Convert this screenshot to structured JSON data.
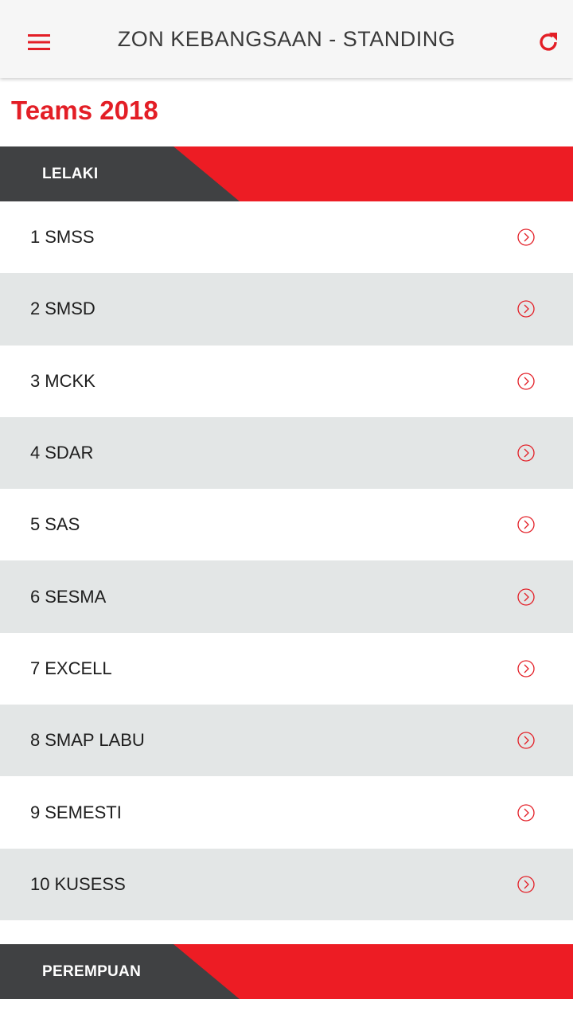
{
  "header": {
    "title": "ZON KEBANGSAAN - STANDING",
    "menu_icon": "hamburger-menu-icon",
    "refresh_icon": "refresh-icon"
  },
  "heading": "Teams 2018",
  "sections": [
    {
      "label": "LELAKI",
      "teams": [
        {
          "rank": "1",
          "name": "SMSS"
        },
        {
          "rank": "2",
          "name": "SMSD"
        },
        {
          "rank": "3",
          "name": "MCKK"
        },
        {
          "rank": "4",
          "name": "SDAR"
        },
        {
          "rank": "5",
          "name": "SAS"
        },
        {
          "rank": "6",
          "name": "SESMA"
        },
        {
          "rank": "7",
          "name": "EXCELL"
        },
        {
          "rank": "8",
          "name": "SMAP LABU"
        },
        {
          "rank": "9",
          "name": "SEMESTI"
        },
        {
          "rank": "10",
          "name": "KUSESS"
        }
      ]
    },
    {
      "label": "PEREMPUAN",
      "teams": []
    }
  ],
  "colors": {
    "accent": "#e31e26",
    "header_dark": "#404143",
    "row_alt": "#e3e6e6",
    "appbar_bg": "#f6f6f6"
  }
}
